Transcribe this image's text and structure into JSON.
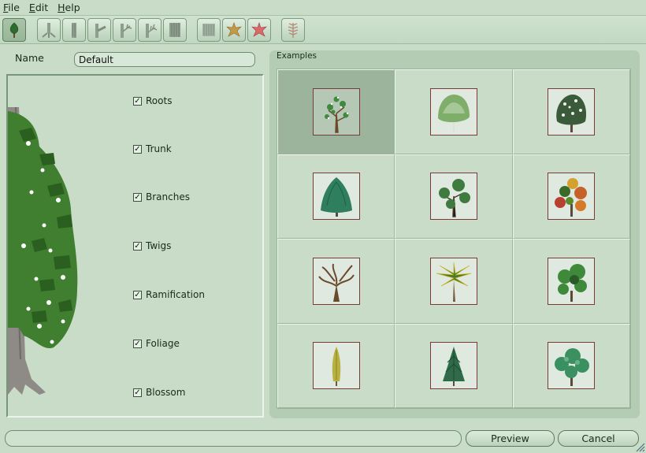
{
  "menu": {
    "file": {
      "key": "F",
      "rest": "ile"
    },
    "edit": {
      "key": "E",
      "rest": "dit"
    },
    "help": {
      "key": "H",
      "rest": "elp"
    }
  },
  "toolbar": {
    "buttons": [
      "tree-icon",
      "roots-icon",
      "trunk-icon",
      "branches-icon",
      "twigs-icon",
      "ramification-icon",
      "bark-texture-icon",
      "leaf-icon",
      "blossom-icon",
      "fern-icon"
    ]
  },
  "name_row": {
    "label": "Name",
    "value": "Default"
  },
  "components": [
    {
      "label": "Roots",
      "checked": true
    },
    {
      "label": "Trunk",
      "checked": true
    },
    {
      "label": "Branches",
      "checked": true
    },
    {
      "label": "Twigs",
      "checked": true
    },
    {
      "label": "Ramification",
      "checked": true
    },
    {
      "label": "Foliage",
      "checked": true
    },
    {
      "label": "Blossom",
      "checked": true
    }
  ],
  "examples": {
    "title": "Examples",
    "selected_index": 0,
    "count": 12
  },
  "buttons": {
    "preview": "Preview",
    "cancel": "Cancel"
  },
  "check_mark": "✓",
  "colors": {
    "background": "#c8dcc8",
    "selected_cell": "#9cb49c",
    "thumb_border": "#7a3a3a"
  }
}
